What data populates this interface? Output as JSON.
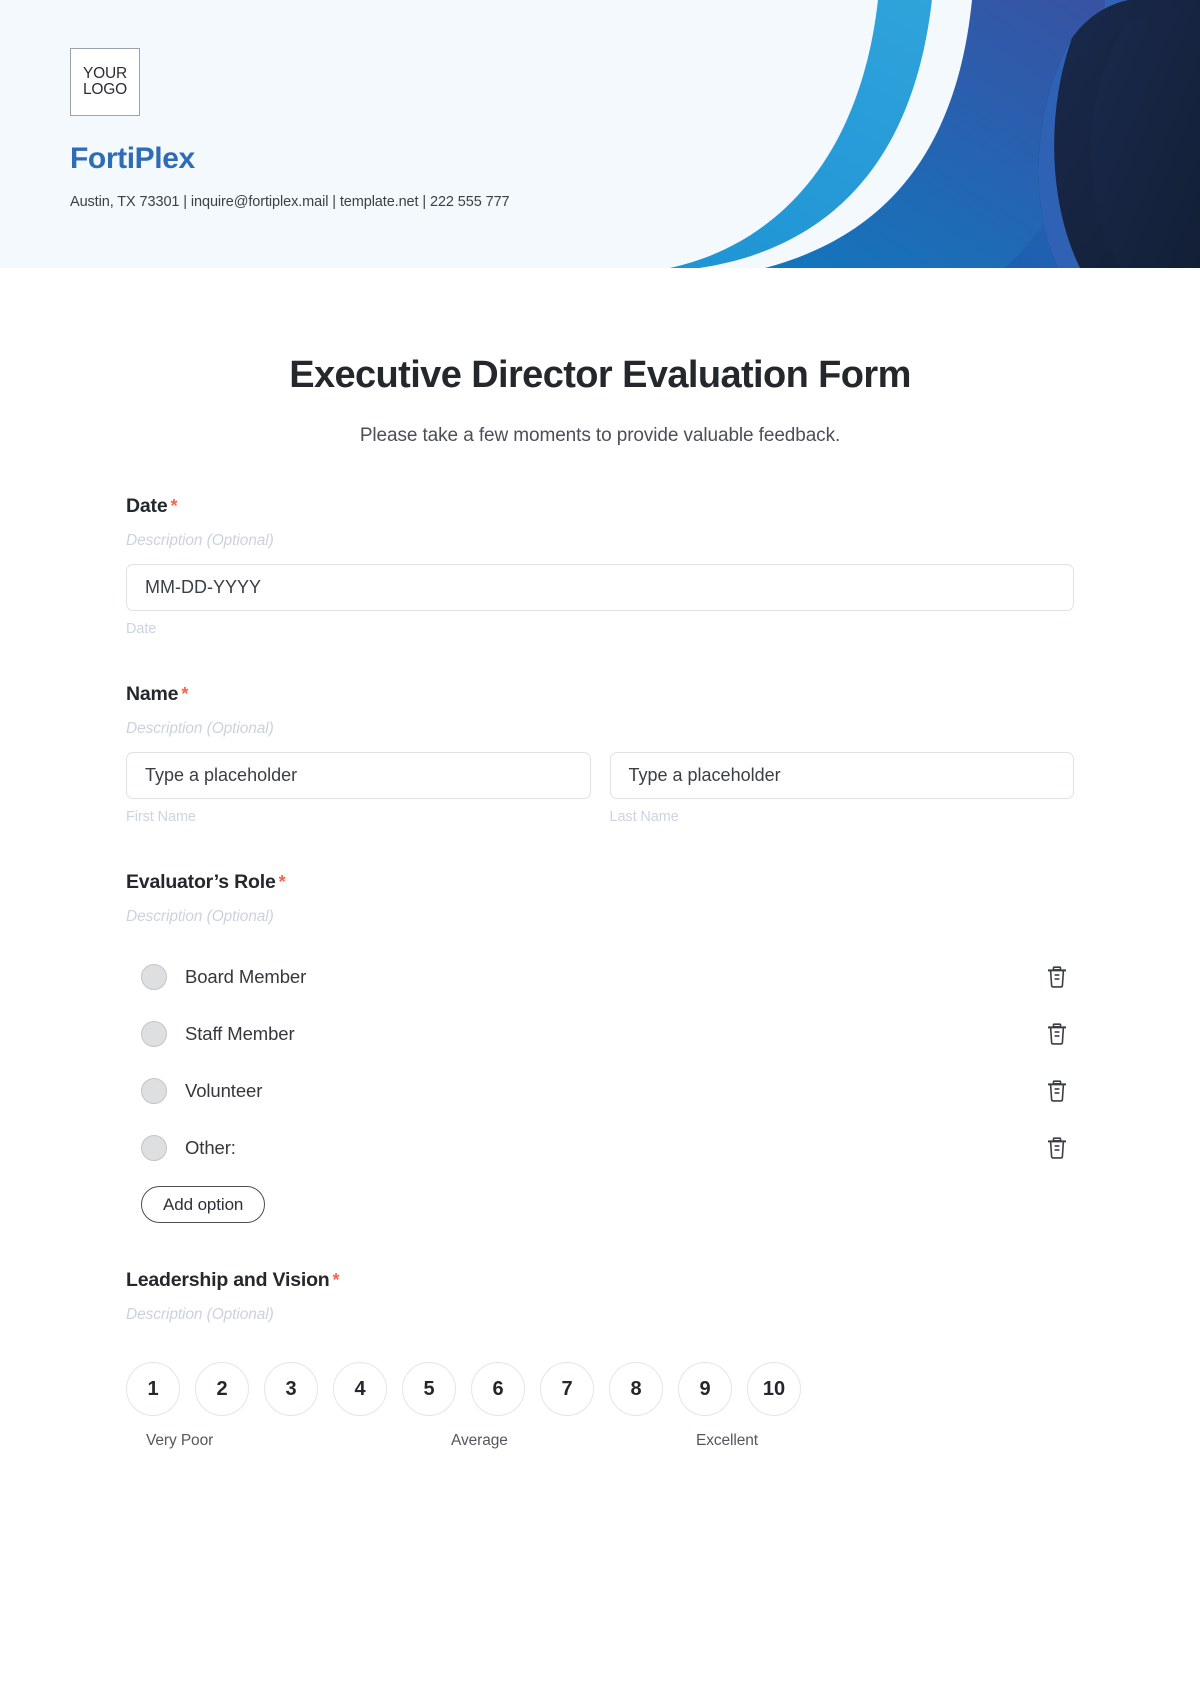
{
  "brand": {
    "logo_line1": "YOUR",
    "logo_line2": "LOGO",
    "name": "FortiPlex",
    "contact": "Austin, TX 73301 | inquire@fortiplex.mail | template.net | 222 555 777",
    "brand_color": "#2f6cb5",
    "header_bg": "#f4f9fd",
    "swirl_colors": [
      "#2a9fd8",
      "#2d7dc4",
      "#1e5ca8",
      "#2b4f9e",
      "#1b2c4f",
      "#16253f"
    ]
  },
  "form": {
    "title": "Executive Director Evaluation Form",
    "subtitle": "Please take a few moments to provide valuable feedback.",
    "required_marker": "*",
    "description_placeholder": "Description (Optional)",
    "fields": [
      {
        "label": "Date",
        "required": true,
        "description": "Description (Optional)",
        "type": "date",
        "placeholder": "MM-DD-YYYY",
        "sublabel": "Date"
      },
      {
        "label": "Name",
        "required": true,
        "description": "Description (Optional)",
        "type": "name",
        "inputs": [
          {
            "placeholder": "Type a placeholder",
            "sublabel": "First Name"
          },
          {
            "placeholder": "Type a placeholder",
            "sublabel": "Last Name"
          }
        ]
      },
      {
        "label": "Evaluator’s Role",
        "required": true,
        "description": "Description (Optional)",
        "type": "radio",
        "options": [
          {
            "label": "Board Member",
            "delete_icon": "trash-icon"
          },
          {
            "label": "Staff Member",
            "delete_icon": "trash-icon"
          },
          {
            "label": "Volunteer",
            "delete_icon": "trash-icon"
          },
          {
            "label": "Other:",
            "delete_icon": "trash-icon"
          }
        ],
        "add_option_label": "Add option"
      },
      {
        "label": "Leadership and Vision",
        "required": true,
        "description": "Description (Optional)",
        "type": "scale",
        "scale_values": [
          "1",
          "2",
          "3",
          "4",
          "5",
          "6",
          "7",
          "8",
          "9",
          "10"
        ],
        "scale_low_label": "Very Poor",
        "scale_mid_label": "Average",
        "scale_high_label": "Excellent"
      }
    ]
  }
}
